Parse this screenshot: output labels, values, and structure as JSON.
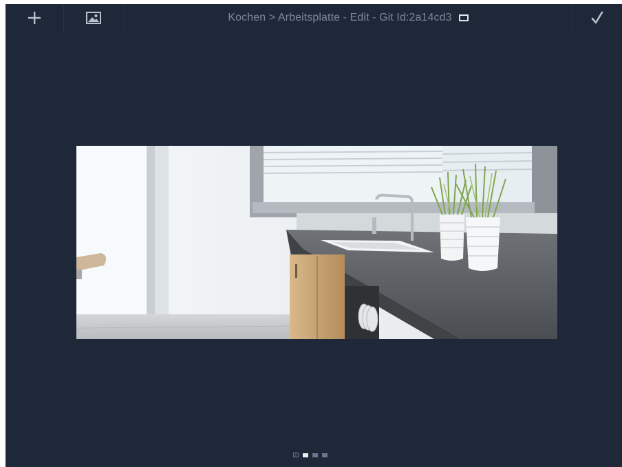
{
  "toolbar": {
    "add_icon": "plus-icon",
    "image_icon": "image-icon",
    "confirm_icon": "checkmark-icon",
    "title": "Kochen > Arbeitsplatte - Edit - Git Id:2a14cd3",
    "title_badge_icon": "rectangle-icon"
  },
  "gallery": {
    "image_subject": "kitchen-countertop-photo",
    "page_count": 4,
    "active_page": 2,
    "first_indicator_icon": "grid-icon"
  },
  "colors": {
    "background": "#1e2838",
    "title_text": "#7c8797",
    "icon": "#b9c1cc",
    "dot_active": "#e8edf2",
    "dot_inactive": "#6b7686"
  }
}
